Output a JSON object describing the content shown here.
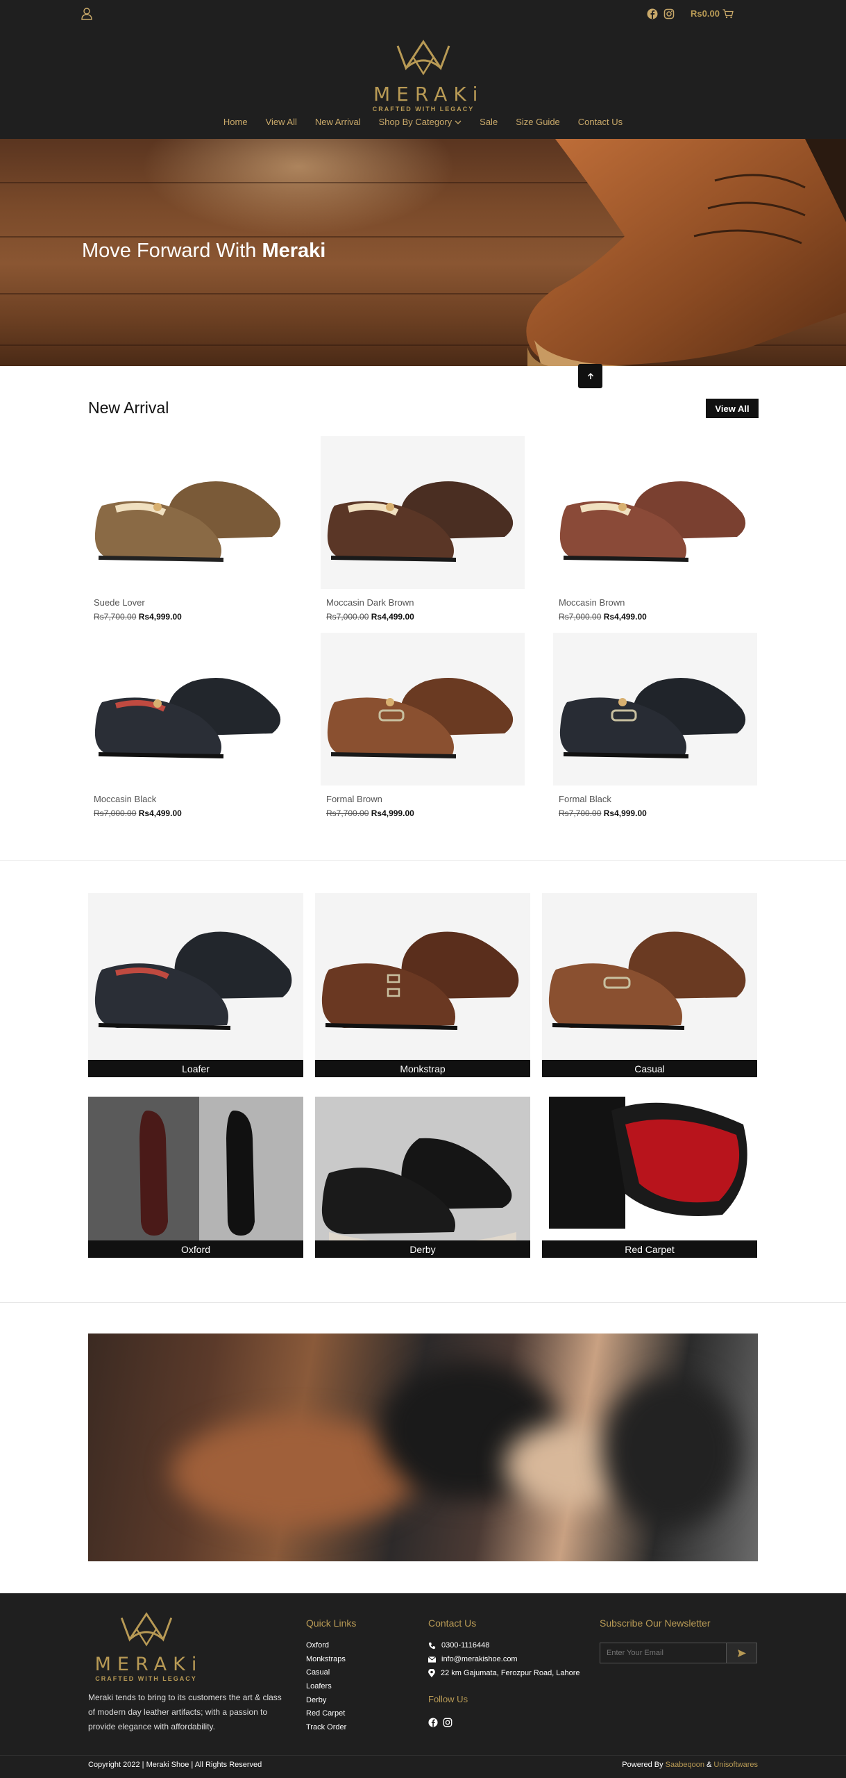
{
  "header": {
    "cart_total": "Rs0.00",
    "brand_name": "MERAKi",
    "brand_tagline": "CRAFTED WITH LEGACY",
    "nav": [
      "Home",
      "View All",
      "New Arrival",
      "Shop By Category",
      "Sale",
      "Size Guide",
      "Contact Us"
    ]
  },
  "hero": {
    "title_prefix": "Move Forward With ",
    "title_bold": "Meraki"
  },
  "new_arrival": {
    "title": "New Arrival",
    "view_all": "View All",
    "products": [
      {
        "name": "Suede Lover",
        "old_price": "Rs7,700.00",
        "new_price": "Rs4,999.00"
      },
      {
        "name": "Moccasin Dark Brown",
        "old_price": "Rs7,000.00",
        "new_price": "Rs4,499.00"
      },
      {
        "name": "Moccasin Brown",
        "old_price": "Rs7,000.00",
        "new_price": "Rs4,499.00"
      },
      {
        "name": "Moccasin Black",
        "old_price": "Rs7,000.00",
        "new_price": "Rs4,499.00"
      },
      {
        "name": "Formal Brown",
        "old_price": "Rs7,700.00",
        "new_price": "Rs4,999.00"
      },
      {
        "name": "Formal Black",
        "old_price": "Rs7,700.00",
        "new_price": "Rs4,999.00"
      }
    ]
  },
  "categories": [
    "Loafer",
    "Monkstrap",
    "Casual",
    "Oxford",
    "Derby",
    "Red Carpet"
  ],
  "footer": {
    "brand_name": "MERAKi",
    "brand_tagline": "CRAFTED WITH LEGACY",
    "about": "Meraki tends to bring to its customers the art & class of modern day leather artifacts; with a passion to provide elegance with affordability.",
    "quick_links_title": "Quick Links",
    "quick_links": [
      "Oxford",
      "Monkstraps",
      "Casual",
      "Loafers",
      "Derby",
      "Red Carpet",
      "Track Order"
    ],
    "contact_title": "Contact Us",
    "phone": "0300-1116448",
    "email": "info@merakishoe.com",
    "address": "22 km Gajumata, Ferozpur Road, Lahore",
    "follow_title": "Follow Us",
    "newsletter_title": "Subscribe Our Newsletter",
    "newsletter_placeholder": "Enter Your Email",
    "copyright": "Copyright 2022 | Meraki Shoe | All Rights Reserved",
    "powered_by": "Powered By",
    "company_1": "Saabeqoon",
    "amp": "&",
    "company_2": "Unisoftwares"
  },
  "colors": {
    "header_bg": "#1f1f1f",
    "gold": "#b89a55",
    "button_bg": "#111111"
  }
}
